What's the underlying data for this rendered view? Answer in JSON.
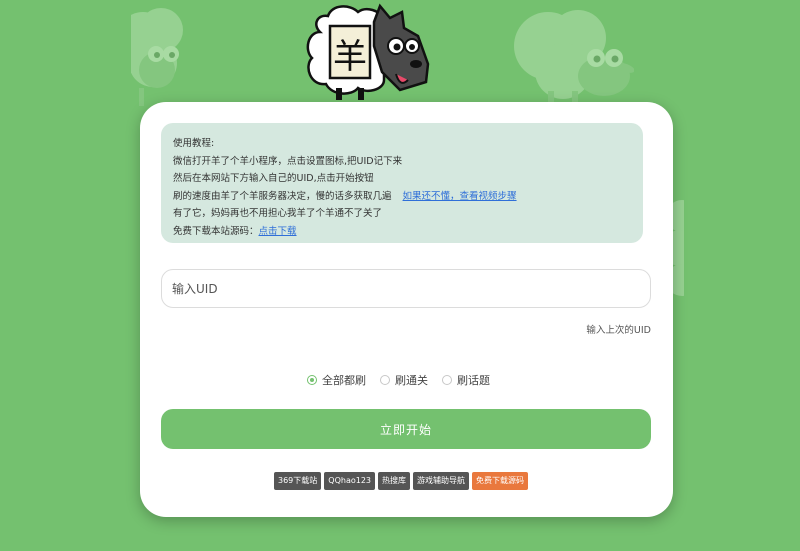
{
  "notice": {
    "title": "使用教程:",
    "line1": "微信打开羊了个羊小程序，点击设置图标,把UID记下来",
    "line2": "然后在本网站下方输入自己的UID,点击开始按钮",
    "line3_text": "刷的速度由羊了个羊服务器决定，慢的话多获取几遍",
    "line3_link": "如果还不懂，查看视频步骤",
    "line4": "有了它，妈妈再也不用担心我羊了个羊通不了关了",
    "line5_text": "免费下载本站源码：",
    "line5_link": "点击下载"
  },
  "uid": {
    "placeholder": "输入UID",
    "value": ""
  },
  "last_uid_label": "输入上次的UID",
  "modes": [
    {
      "label": "全部都刷",
      "selected": true
    },
    {
      "label": "刷通关",
      "selected": false
    },
    {
      "label": "刷话题",
      "selected": false
    }
  ],
  "start_label": "立即开始",
  "footer_links": [
    {
      "label": "369下载站",
      "color": "#555555"
    },
    {
      "label": "QQhao123",
      "color": "#555555"
    },
    {
      "label": "热搜库",
      "color": "#555555"
    },
    {
      "label": "游戏辅助导航",
      "color": "#555555"
    },
    {
      "label": "免费下载源码",
      "color": "#e9783d"
    }
  ],
  "logo_char": "羊",
  "colors": {
    "background": "#74c16f",
    "accent": "#74c16f",
    "notice_bg": "#d5e8df"
  }
}
